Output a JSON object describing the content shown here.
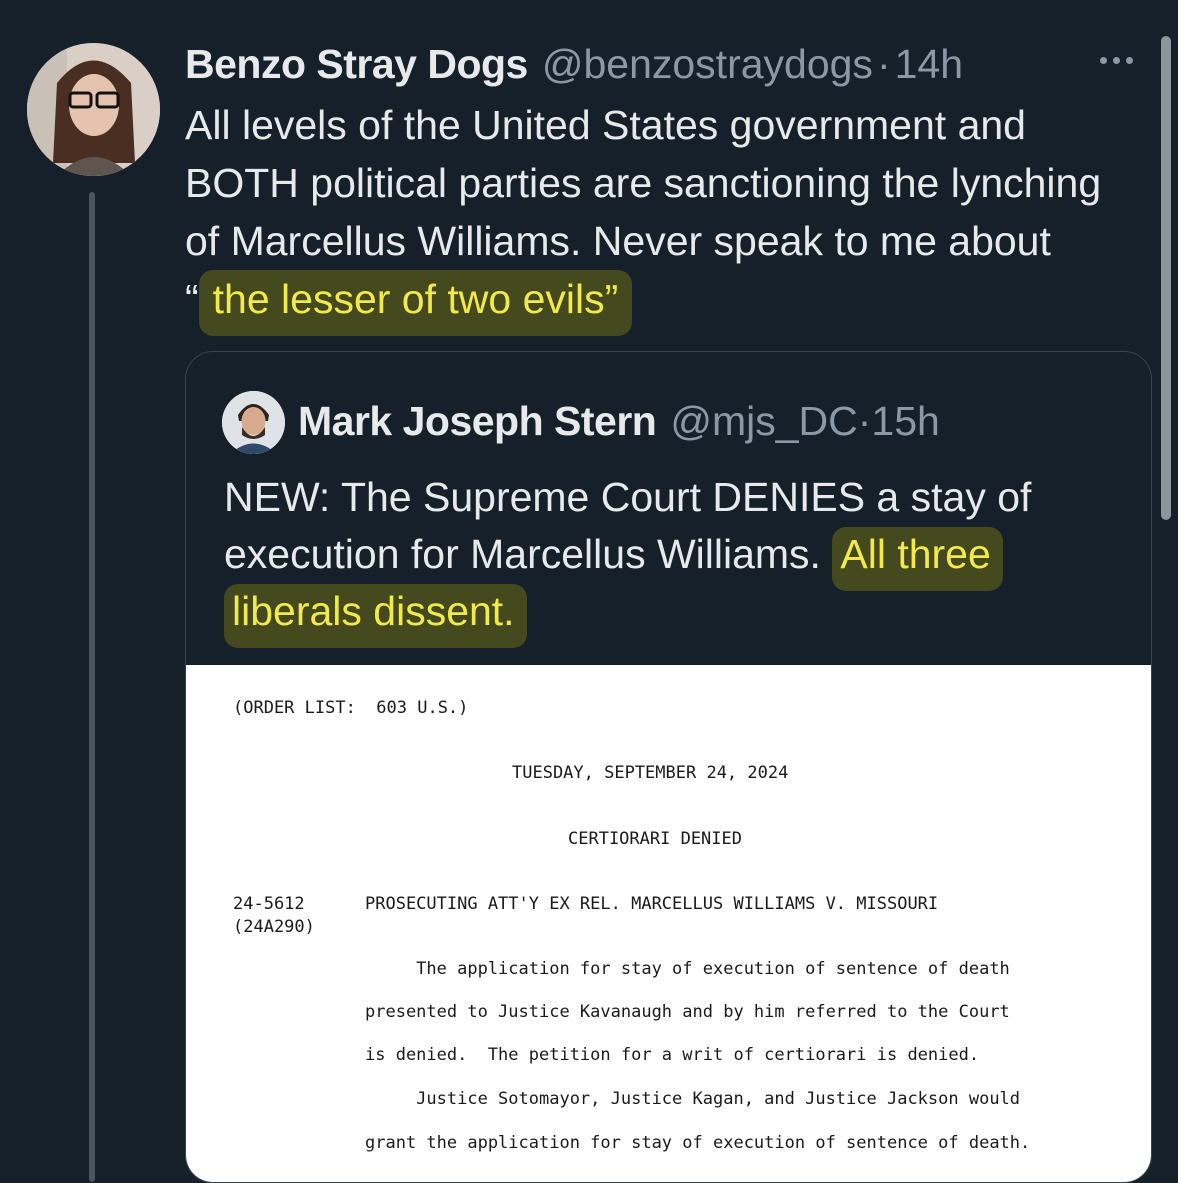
{
  "tweet": {
    "author_name": "Benzo Stray Dogs",
    "handle": "@benzostraydogs",
    "separator": "·",
    "time": "14h",
    "text_before": "All levels of the United States government and BOTH political parties are sanctioning the lynching of Marcellus Williams. Never speak to me about “",
    "text_highlight": "the lesser of two evils”",
    "more_icon": "more-horizontal-icon"
  },
  "quoted": {
    "author_name": "Mark Joseph Stern",
    "handle": "@mjs_DC",
    "separator": "·",
    "time": "15h",
    "text_before": "NEW: The Supreme Court DENIES a stay of execution for Marcellus Williams.",
    "text_highlight": "All three liberals dissent."
  },
  "document": {
    "order_list": "(ORDER LIST:  603 U.S.)",
    "date": "TUESDAY, SEPTEMBER 24, 2024",
    "section": "CERTIORARI DENIED",
    "case_number": "24-5612",
    "application_number": "(24A290)",
    "case_title": "PROSECUTING ATT'Y EX REL. MARCELLUS WILLIAMS V. MISSOURI",
    "lines": [
      "     The application for stay of execution of sentence of death",
      "presented to Justice Kavanaugh and by him referred to the Court",
      "is denied.  The petition for a writ of certiorari is denied.",
      "     Justice Sotomayor, Justice Kagan, and Justice Jackson would",
      "grant the application for stay of execution of sentence of death."
    ]
  },
  "colors": {
    "background": "#15202b",
    "text": "#e7e9ea",
    "secondary": "#8b98a5",
    "highlight": "#f2e94b"
  }
}
